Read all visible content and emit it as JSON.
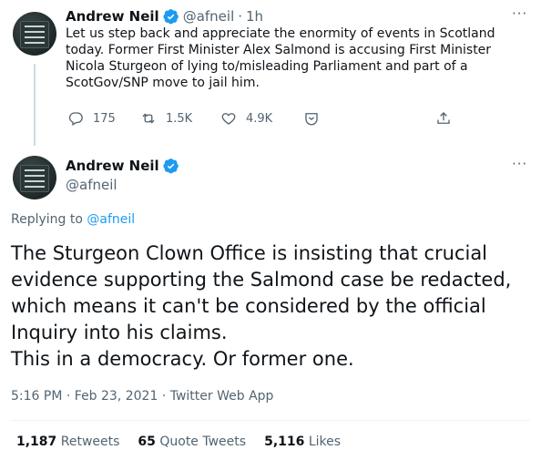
{
  "colors": {
    "accent": "#1d9bf0",
    "text": "#0f1419",
    "muted": "#536471",
    "line": "#cfd9de"
  },
  "tweet1": {
    "author_name": "Andrew Neil",
    "handle": "@afneil",
    "separator": "·",
    "time": "1h",
    "more": "···",
    "text": "Let us step back and appreciate the enormity of events in Scotland today. Former First Minister Alex Salmond is accusing First Minister Nicola Sturgeon of lying to/misleading Parliament and part of a ScotGov/SNP move to jail him.",
    "actions": {
      "reply_count": "175",
      "retweet_count": "1.5K",
      "like_count": "4.9K"
    }
  },
  "tweet2": {
    "author_name": "Andrew Neil",
    "handle": "@afneil",
    "more": "···",
    "replying_label": "Replying to",
    "replying_handle": "@afneil",
    "text_lines": [
      "The Sturgeon Clown Office is insisting that crucial",
      "evidence supporting the Salmond case be redacted,",
      "which means it can't be considered by the official",
      "Inquiry into his claims.",
      "This in a democracy. Or former one."
    ],
    "time": "5:16 PM",
    "date": "Feb 23, 2021",
    "source": "Twitter Web App",
    "meta_separator": "·",
    "stats": {
      "retweets_count": "1,187",
      "retweets_label": "Retweets",
      "quote_count": "65",
      "quote_label": "Quote Tweets",
      "likes_count": "5,116",
      "likes_label": "Likes"
    }
  }
}
